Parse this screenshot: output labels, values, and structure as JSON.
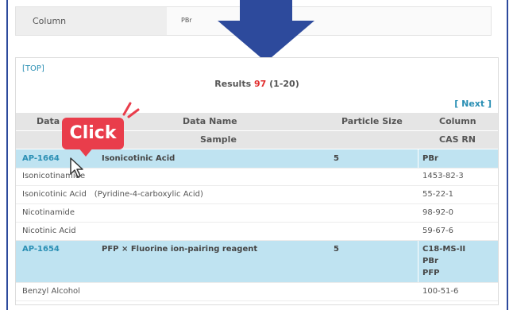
{
  "form": {
    "label": "Column",
    "value": "PBr"
  },
  "nav": {
    "top_link": "[TOP]",
    "next_link": "[ Next ]"
  },
  "results": {
    "prefix": "Results",
    "count": "97",
    "range": "(1-20)"
  },
  "table": {
    "headers": {
      "data_no": "Data",
      "data_name": "Data Name",
      "particle_size": "Particle Size",
      "column": "Column",
      "sample": "Sample",
      "cas_rn": "CAS RN"
    },
    "rows": [
      {
        "type": "product",
        "code": "AP-1664",
        "name": "Isonicotinic Acid",
        "size": "5",
        "column": [
          "PBr"
        ]
      },
      {
        "type": "sample",
        "name": "Isonicotinamide",
        "cas": "1453-82-3"
      },
      {
        "type": "sample",
        "name": "Isonicotinic Acid　(Pyridine-4-carboxylic Acid)",
        "cas": "55-22-1"
      },
      {
        "type": "sample",
        "name": "Nicotinamide",
        "cas": "98-92-0"
      },
      {
        "type": "sample",
        "name": "Nicotinic Acid",
        "cas": "59-67-6"
      },
      {
        "type": "product",
        "code": "AP-1654",
        "name": "PFP × Fluorine ion-pairing reagent",
        "size": "5",
        "column": [
          "C18-MS-II",
          "PBr",
          "PFP"
        ]
      },
      {
        "type": "sample",
        "name": "Benzyl Alcohol",
        "cas": "100-51-6"
      }
    ]
  },
  "callout": {
    "text": "Click"
  },
  "colors": {
    "frame": "#2d4a9c",
    "accent": "#e93d4b",
    "link": "#2a8fb4",
    "highlight": "#bfe3f1"
  },
  "icons": {
    "arrow": "down-arrow-icon",
    "pointer": "hand-pointer-icon",
    "burst": "emphasis-burst-icon"
  }
}
